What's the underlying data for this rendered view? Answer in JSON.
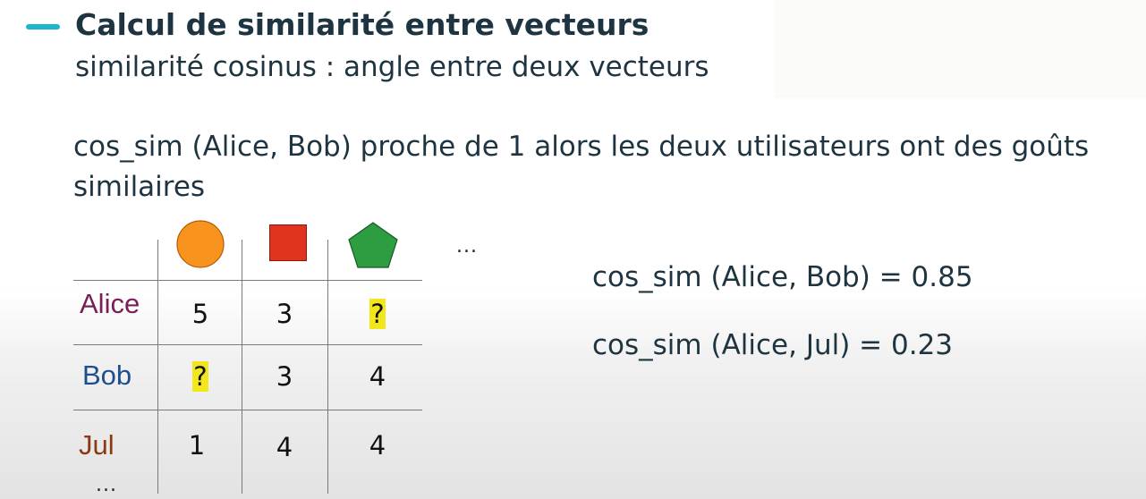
{
  "slide": {
    "title": "Calcul de similarité entre vecteurs",
    "subtitle": "similarité cosinus : angle entre deux vecteurs",
    "paragraph": "cos_sim (Alice, Bob) proche de 1 alors les deux utilisateurs ont des goûts similaires"
  },
  "table": {
    "column_shapes": [
      {
        "icon": "circle-icon",
        "color": "#f7931e"
      },
      {
        "icon": "square-icon",
        "color": "#e0341f"
      },
      {
        "icon": "pentagon-icon",
        "color": "#2e9c41"
      }
    ],
    "column_ellipsis": "...",
    "rows": [
      {
        "label": "Alice",
        "label_color": "#7a1f55",
        "cells": [
          "5",
          "3",
          "?"
        ]
      },
      {
        "label": "Bob",
        "label_color": "#1f4e8c",
        "cells": [
          "?",
          "3",
          "4"
        ]
      },
      {
        "label": "Jul",
        "label_color": "#8a3a12",
        "cells": [
          "1",
          "4",
          "4"
        ]
      }
    ],
    "row_ellipsis": "...",
    "highlight_color": "#f2e61c"
  },
  "results": [
    "cos_sim (Alice, Bob) = 0.85",
    "cos_sim (Alice, Jul) = 0.23"
  ]
}
